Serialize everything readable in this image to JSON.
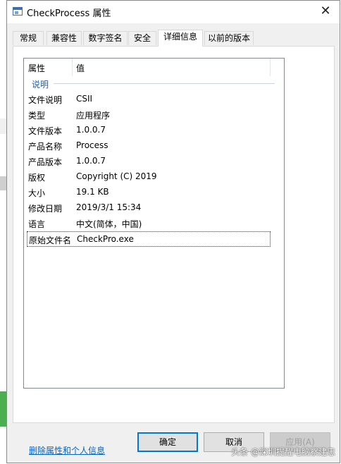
{
  "window": {
    "title": "CheckProcess 属性",
    "close_icon": "close-icon"
  },
  "tabs": [
    {
      "label": "常规"
    },
    {
      "label": "兼容性"
    },
    {
      "label": "数字签名"
    },
    {
      "label": "安全"
    },
    {
      "label": "详细信息",
      "active": true
    },
    {
      "label": "以前的版本"
    }
  ],
  "list": {
    "col_property": "属性",
    "col_value": "值",
    "group": "说明",
    "rows": [
      {
        "key": "文件说明",
        "value": "CSII"
      },
      {
        "key": "类型",
        "value": "应用程序"
      },
      {
        "key": "文件版本",
        "value": "1.0.0.7"
      },
      {
        "key": "产品名称",
        "value": "Process"
      },
      {
        "key": "产品版本",
        "value": "1.0.0.7"
      },
      {
        "key": "版权",
        "value": "Copyright (C) 2019"
      },
      {
        "key": "大小",
        "value": "19.1 KB"
      },
      {
        "key": "修改日期",
        "value": "2019/3/1 15:34"
      },
      {
        "key": "语言",
        "value": "中文(简体，中国)"
      },
      {
        "key": "原始文件名",
        "value": "CheckPro.exe",
        "selected": true
      }
    ]
  },
  "delete_link": "删除属性和个人信息",
  "buttons": {
    "ok": "确定",
    "cancel": "取消",
    "apply": "应用(A)"
  },
  "watermark": "头条 @深圳提醒电脑察建忠",
  "colors": {
    "accent": "#0078d7",
    "link": "#0066cc",
    "group": "#1e5fb4"
  }
}
